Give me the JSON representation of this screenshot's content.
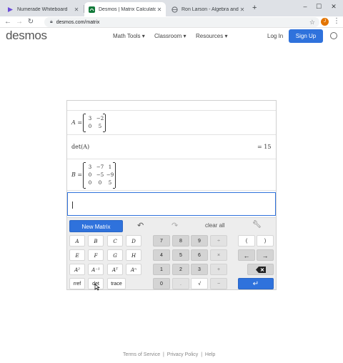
{
  "browser": {
    "tabs": [
      {
        "title": "Numerade Whiteboard",
        "icon": "numerade-favicon"
      },
      {
        "title": "Desmos | Matrix Calculator",
        "icon": "desmos-favicon"
      },
      {
        "title": "Ron Larson - Algebra and Trigo",
        "icon": "globe-favicon"
      }
    ],
    "new_tab": "+",
    "url": "desmos.com/matrix",
    "profile_initial": "J"
  },
  "header": {
    "logo": "desmos",
    "nav": [
      "Math Tools ▾",
      "Classroom ▾",
      "Resources ▾"
    ],
    "login": "Log In",
    "signup": "Sign Up"
  },
  "calculator": {
    "expressions": [
      {
        "lhs": "A =",
        "matrix": [
          [
            "3",
            "−2"
          ],
          [
            "0",
            "5"
          ]
        ]
      },
      {
        "lhs": "det(A)",
        "result": "= 15"
      },
      {
        "lhs": "B =",
        "matrix": [
          [
            "3",
            "−7",
            "1"
          ],
          [
            "0",
            "−5",
            "−9"
          ],
          [
            "0",
            "0",
            "5"
          ]
        ]
      }
    ],
    "input_value": "",
    "toolbar": {
      "new_matrix": "New Matrix",
      "clear_all": "clear all"
    },
    "keys": {
      "matrices": [
        "A",
        "B",
        "C",
        "D",
        "E",
        "F",
        "G",
        "H"
      ],
      "ops": [
        "A²",
        "A⁻¹",
        "Aᵀ",
        "Aⁿ"
      ],
      "funcs": [
        "rref",
        "det",
        "trace"
      ],
      "digits": [
        [
          "7",
          "8",
          "9",
          "÷"
        ],
        [
          "4",
          "5",
          "6",
          "×"
        ],
        [
          "1",
          "2",
          "3",
          "+"
        ],
        [
          "0",
          ".",
          "√",
          "−"
        ]
      ],
      "parens": [
        "(",
        ")"
      ],
      "arrows": [
        "←",
        "→"
      ],
      "enter": "↵"
    }
  },
  "footer": {
    "links": [
      "Terms of Service",
      "Privacy Policy",
      "Help"
    ],
    "separator": "|"
  },
  "colors": {
    "accent": "#2f72dc",
    "keypad_bg": "#ededed"
  }
}
